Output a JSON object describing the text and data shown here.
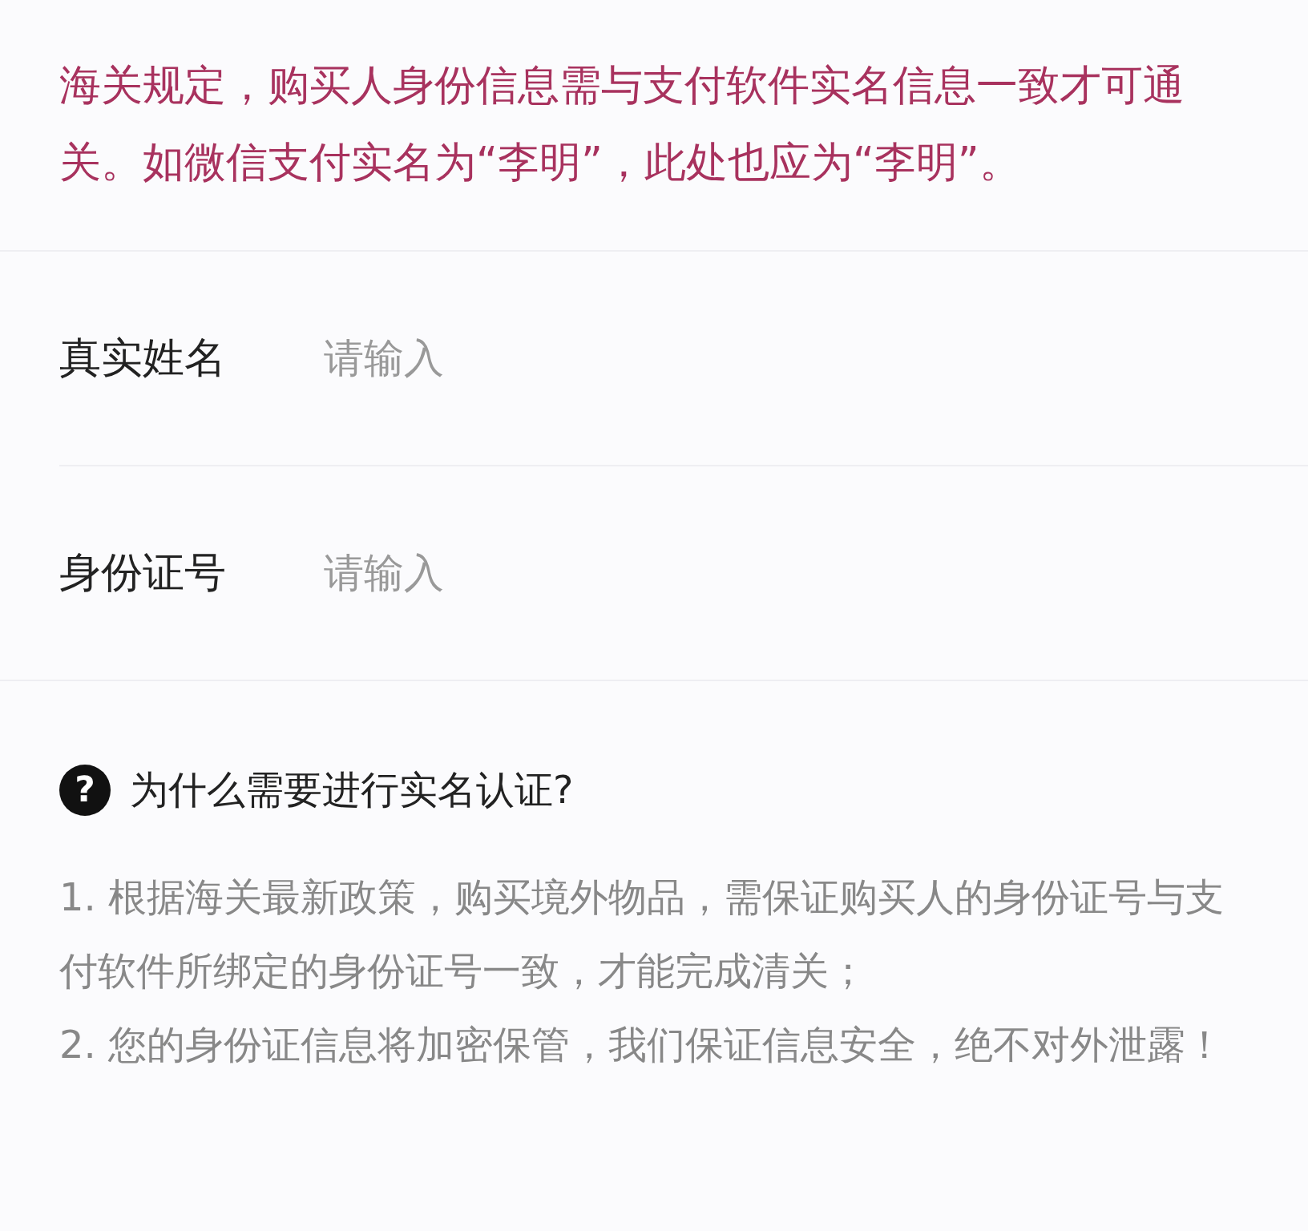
{
  "notice": "海关规定，购买人身份信息需与支付软件实名信息一致才可通关。如微信支付实名为“李明”，此处也应为“李明”。",
  "fields": [
    {
      "label": "真实姓名",
      "placeholder": "请输入"
    },
    {
      "label": "身份证号",
      "placeholder": "请输入"
    }
  ],
  "faq": {
    "question": "为什么需要进行实名认证?",
    "icon": "?",
    "answers": [
      "1. 根据海关最新政策，购买境外物品，需保证购买人的身份证号与支付软件所绑定的身份证号一致，才能完成清关；",
      "2. 您的身份证信息将加密保管，我们保证信息安全，绝不对外泄露！"
    ]
  }
}
